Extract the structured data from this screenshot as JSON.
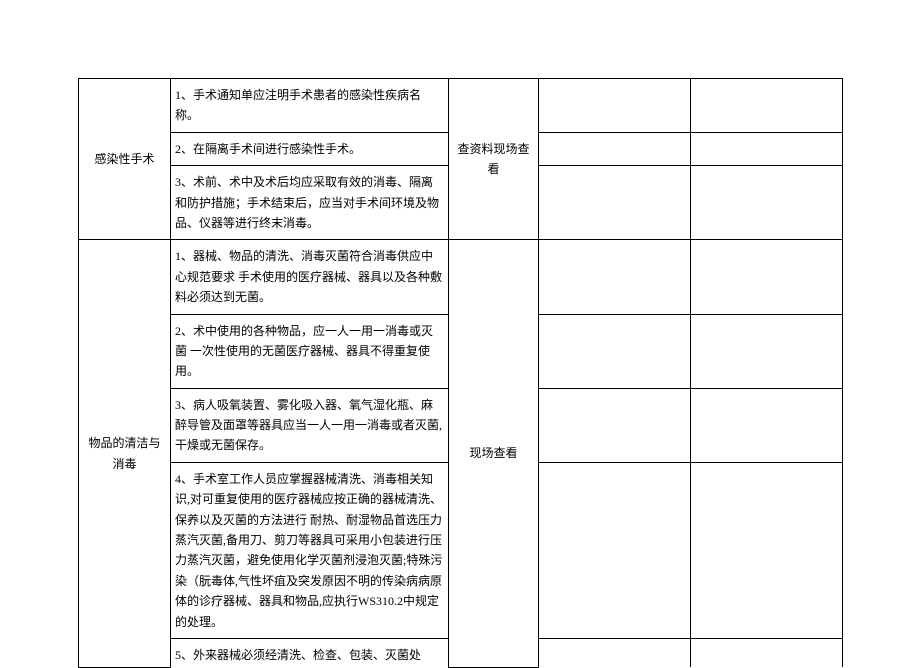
{
  "sections": [
    {
      "category": "感染性手术",
      "method": "查资料现场查看",
      "items": [
        "1、手术通知单应注明手术患者的感染性疾病名称。",
        "2、在隔离手术间进行感染性手术。",
        "3、术前、术中及术后均应采取有效的消毒、隔离和防护措施；手术结束后，应当对手术间环境及物品、仪器等进行终末消毒。"
      ]
    },
    {
      "category": "物品的清洁与消毒",
      "method": "现场查看",
      "items": [
        "1、器械、物品的清洗、消毒灭菌符合消毒供应中心规范要求  手术使用的医疗器械、器具以及各种敷料必须达到无菌。",
        "2、术中使用的各种物品，应一人一用一消毒或灭菌  一次性使用的无菌医疗器械、器具不得重复使用。",
        "3、病人吸氧装置、雾化吸入器、氧气湿化瓶、麻醉导管及面罩等器具应当一人一用一消毒或者灭菌,干燥或无菌保存。",
        "4、手术室工作人员应掌握器械清洗、消毒相关知识,对可重复使用的医疗器械应按正确的器械清洗、保养以及灭菌的方法进行  耐热、耐湿物品首选压力蒸汽灭菌,备用刀、剪刀等器具可采用小包装进行压力蒸汽灭菌，避免使用化学灭菌剂浸泡灭菌;特殊污染（朊毒体,气性坏疽及突发原因不明的传染病病原体的诊疗器械、器具和物品,应执行WS310.2中规定的处理。",
        "5、外来器械必须经清洗、检查、包装、灭菌处"
      ]
    }
  ]
}
